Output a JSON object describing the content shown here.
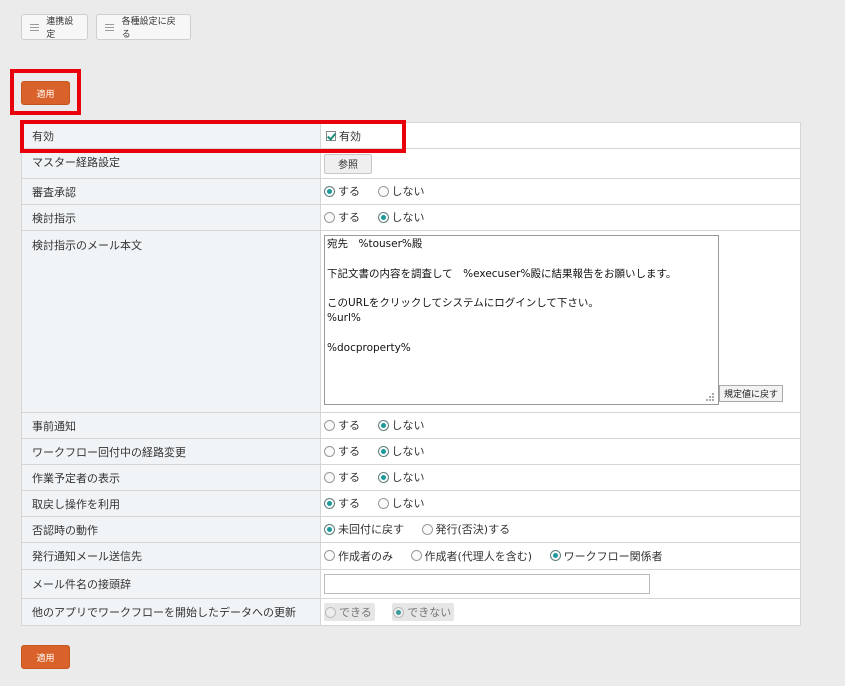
{
  "toolbar": {
    "link_settings_label": "連携設定",
    "back_settings_label": "各種設定に戻る"
  },
  "apply_label": "適用",
  "rows": {
    "enabled": {
      "label": "有効",
      "check_label": "有効",
      "checked": true
    },
    "master_route": {
      "label": "マスター経路設定",
      "button": "参照"
    },
    "review_approval": {
      "label": "審査承認",
      "opt_yes": "する",
      "opt_no": "しない",
      "selected": "する"
    },
    "review_instruction": {
      "label": "検討指示",
      "opt_yes": "する",
      "opt_no": "しない",
      "selected": "しない"
    },
    "review_mail_body": {
      "label": "検討指示のメール本文",
      "text": "宛先　%touser%殿\n\n下記文書の内容を調査して　%execuser%殿に結果報告をお願いします。\n\nこのURLをクリックしてシステムにログインして下さい。\n%url%\n\n%docproperty%",
      "reset_label": "規定値に戻す"
    },
    "advance_notice": {
      "label": "事前通知",
      "opt_yes": "する",
      "opt_no": "しない",
      "selected": "しない"
    },
    "route_change": {
      "label": "ワークフロー回付中の経路変更",
      "opt_yes": "する",
      "opt_no": "しない",
      "selected": "しない"
    },
    "show_planned": {
      "label": "作業予定者の表示",
      "opt_yes": "する",
      "opt_no": "しない",
      "selected": "しない"
    },
    "undo_operation": {
      "label": "取戻し操作を利用",
      "opt_yes": "する",
      "opt_no": "しない",
      "selected": "する"
    },
    "reject_action": {
      "label": "否認時の動作",
      "opt_a": "未回付に戻す",
      "opt_b": "発行(否決)する",
      "selected": "未回付に戻す"
    },
    "issue_notice_to": {
      "label": "発行通知メール送信先",
      "opt_a": "作成者のみ",
      "opt_b": "作成者(代理人を含む)",
      "opt_c": "ワークフロー関係者",
      "selected": "ワークフロー関係者"
    },
    "mail_subject_prefix": {
      "label": "メール件名の接頭辞",
      "value": ""
    },
    "other_app_update": {
      "label": "他のアプリでワークフローを開始したデータへの更新",
      "opt_a": "できる",
      "opt_b": "できない",
      "selected": "できない"
    }
  },
  "colors": {
    "accent": "#d9622b",
    "highlight": "#e8000b",
    "radio_on": "#1a9a9a"
  }
}
